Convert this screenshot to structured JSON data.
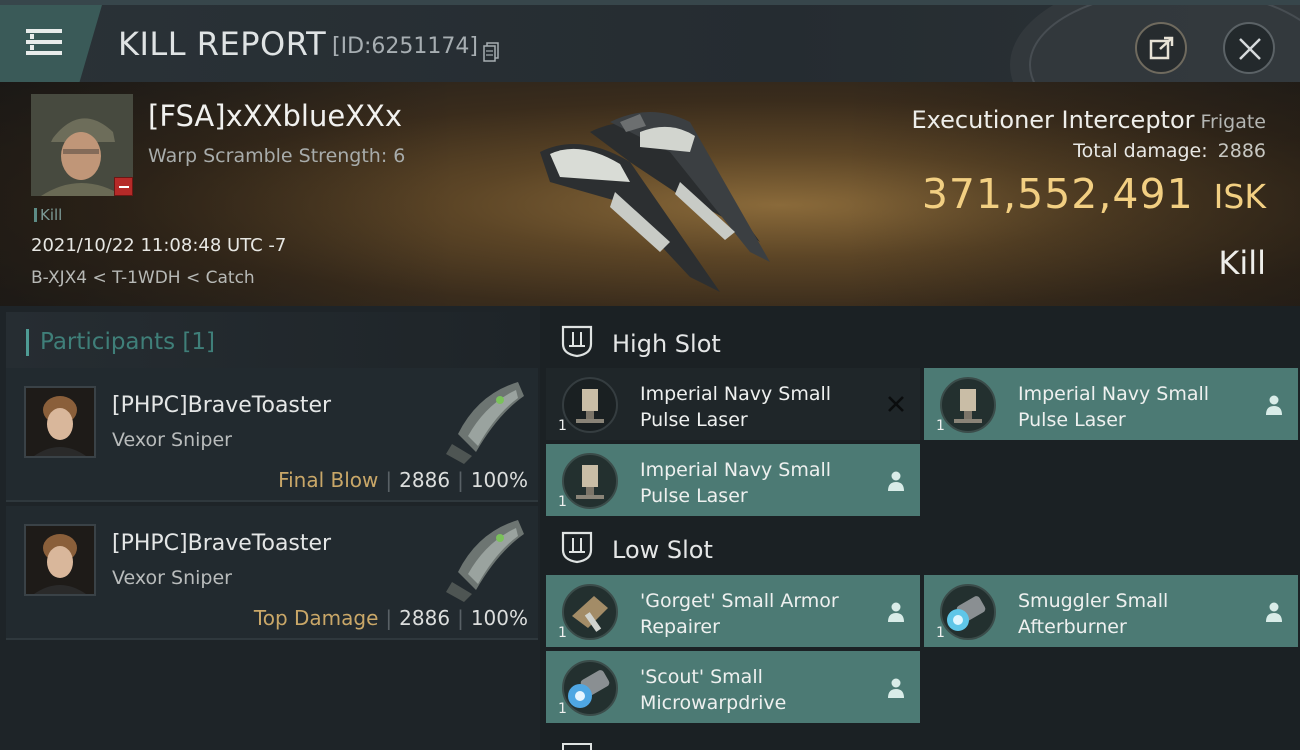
{
  "header": {
    "title": "KILL REPORT",
    "report_id": "[ID:6251174]",
    "icons": {
      "menu": "hamburger-menu-icon",
      "copy": "copy-icon",
      "share": "share-icon",
      "close": "close-icon"
    }
  },
  "victim": {
    "name": "[FSA]xXXblueXXx",
    "warp_scramble": "Warp Scramble Strength: 6",
    "kill_tag": "Kill",
    "datetime": "2021/10/22 11:08:48 UTC -7",
    "location": "B-XJX4 < T-1WDH < Catch",
    "ship": "Executioner Interceptor",
    "ship_class": "Frigate",
    "total_damage_label": "Total damage:",
    "total_damage": "2886",
    "isk_value": "371,552,491",
    "isk_unit": "ISK",
    "result": "Kill"
  },
  "participants": {
    "header": "Participants [1]",
    "list": [
      {
        "name": "[PHPC]BraveToaster",
        "ship": "Vexor Sniper",
        "role": "Final Blow",
        "damage": "2886",
        "percent": "100%"
      },
      {
        "name": "[PHPC]BraveToaster",
        "ship": "Vexor Sniper",
        "role": "Top Damage",
        "damage": "2886",
        "percent": "100%"
      }
    ]
  },
  "fittings": {
    "high_slot": {
      "label": "High Slot",
      "modules": [
        {
          "name": "Imperial Navy Small Pulse Laser",
          "qty": "1",
          "status": "destroyed"
        },
        {
          "name": "Imperial Navy Small Pulse Laser",
          "qty": "1",
          "status": "dropped"
        },
        {
          "name": "Imperial Navy Small Pulse Laser",
          "qty": "1",
          "status": "dropped"
        }
      ]
    },
    "low_slot": {
      "label": "Low Slot",
      "modules": [
        {
          "name": "'Gorget' Small Armor Repairer",
          "qty": "1",
          "status": "dropped"
        },
        {
          "name": "Smuggler Small Afterburner",
          "qty": "1",
          "status": "dropped"
        },
        {
          "name": "'Scout' Small Microwarpdrive",
          "qty": "1",
          "status": "dropped"
        }
      ]
    }
  },
  "colors": {
    "accent_teal": "#4c7a74",
    "isk_gold": "#f2cf82",
    "destroyed_marker": "#111111",
    "final_blow": "#c9a768"
  }
}
